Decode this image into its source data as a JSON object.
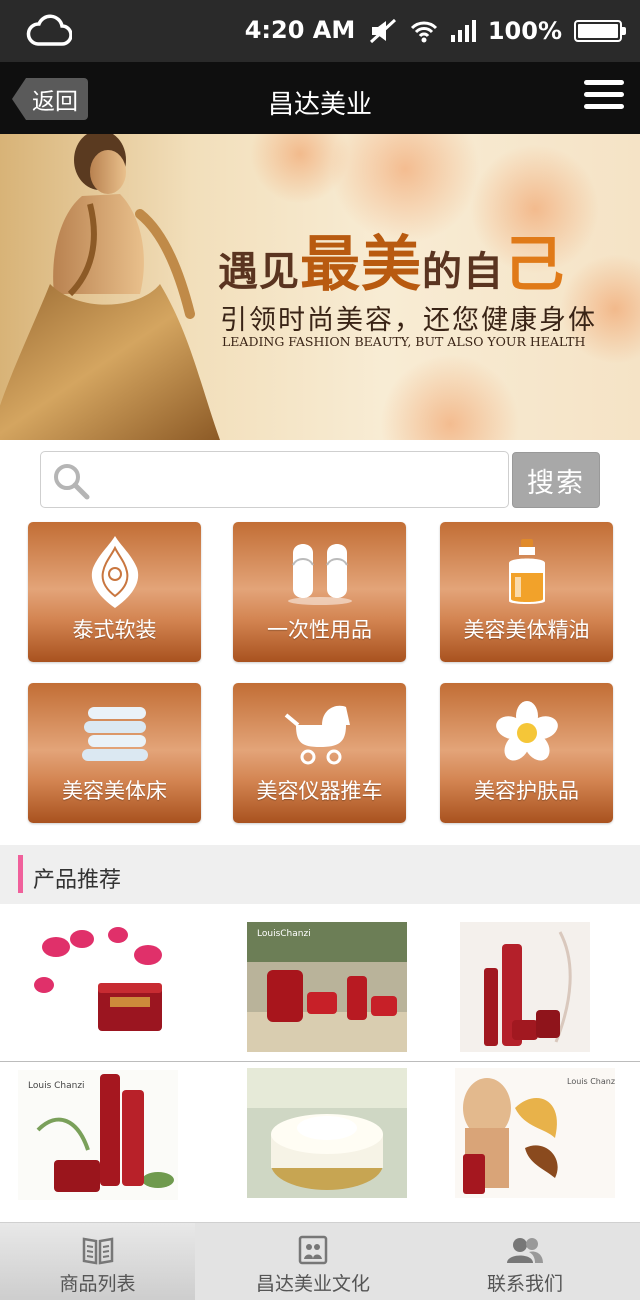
{
  "status_bar": {
    "time": "4:20 AM",
    "battery": "100%",
    "battery_level": 1.0
  },
  "nav": {
    "back_label": "返回",
    "title": "昌达美业"
  },
  "banner": {
    "headline_a": "遇见",
    "headline_b": "最美",
    "headline_c": "的自",
    "headline_d": "己",
    "subtitle": "引领时尚美容，还您健康身体",
    "subtitle_en": "LEADING FASHION BEAUTY, BUT ALSO YOUR HEALTH"
  },
  "search": {
    "placeholder": "",
    "value": "",
    "button_label": "搜索"
  },
  "categories": [
    {
      "label": "泰式软装",
      "icon": "thai-ornament-icon"
    },
    {
      "label": "一次性用品",
      "icon": "slippers-icon"
    },
    {
      "label": "美容美体精油",
      "icon": "oil-bottle-icon"
    },
    {
      "label": "美容美体床",
      "icon": "towels-icon"
    },
    {
      "label": "美容仪器推车",
      "icon": "trolley-icon"
    },
    {
      "label": "美容护肤品",
      "icon": "flower-icon"
    }
  ],
  "section": {
    "title": "产品推荐"
  },
  "products": [
    {
      "icon": "product-image",
      "brand": ""
    },
    {
      "icon": "product-image",
      "brand": "LouisChanzi"
    },
    {
      "icon": "product-image",
      "brand": ""
    },
    {
      "icon": "product-image",
      "brand": "Louis Chanzi"
    },
    {
      "icon": "product-image",
      "brand": ""
    },
    {
      "icon": "product-image",
      "brand": "Louis Chanzi"
    }
  ],
  "tabs": [
    {
      "label": "商品列表",
      "icon": "book-icon",
      "active": true
    },
    {
      "label": "昌达美业文化",
      "icon": "photo-icon",
      "active": false
    },
    {
      "label": "联系我们",
      "icon": "contacts-icon",
      "active": false
    }
  ],
  "colors": {
    "tile": "#c97a45",
    "accent_bar": "#f0609b",
    "nav_bg": "#0f0f0f"
  }
}
